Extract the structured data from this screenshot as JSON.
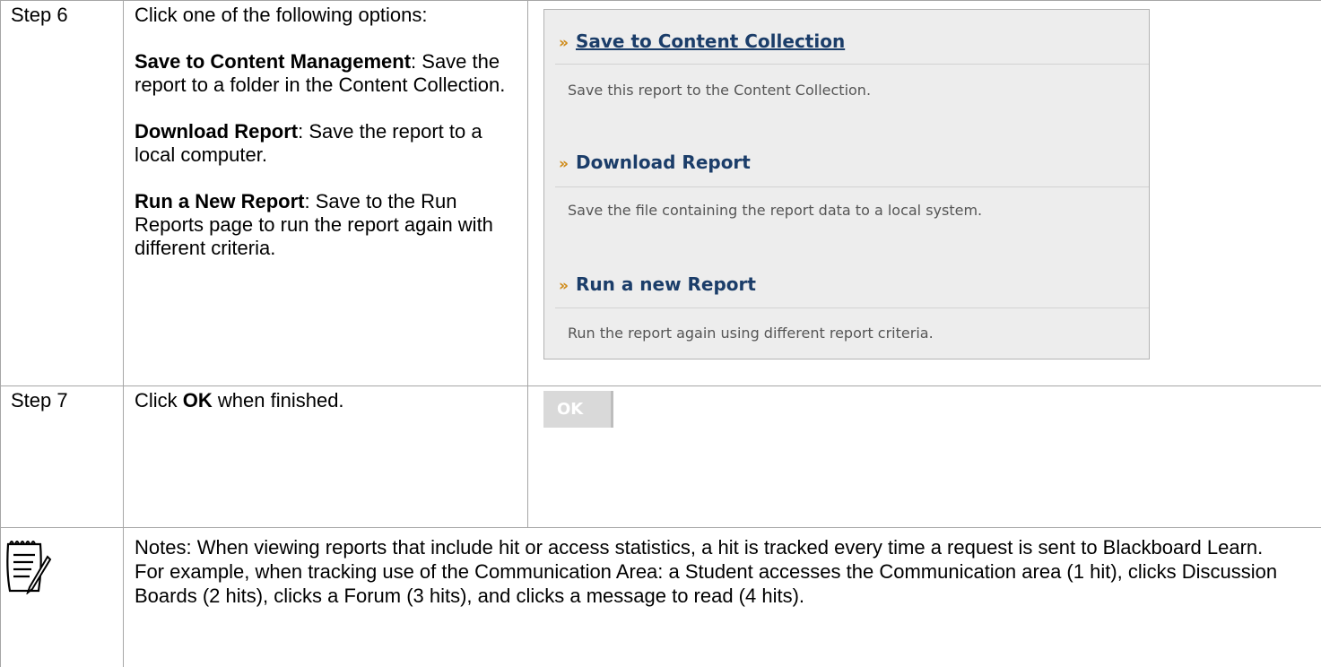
{
  "rows": [
    {
      "step": "Step 6",
      "intro": "Click one of the following options:",
      "options": [
        {
          "name": "Save to Content Management",
          "desc": ": Save the report to a folder in the Content Collection."
        },
        {
          "name": "Download Report",
          "desc": ": Save the report to a local computer."
        },
        {
          "name": "Run a New Report",
          "desc": ": Save to the Run Reports page to run the report again with different criteria."
        }
      ]
    },
    {
      "step": "Step 7",
      "pre": "Click ",
      "bold": "OK",
      "post": " when finished."
    }
  ],
  "panel": {
    "items": [
      {
        "title": "Save to Content Collection",
        "desc": "Save this report to the Content Collection.",
        "link": true
      },
      {
        "title": "Download Report",
        "desc": "Save the file containing the report data to a local system.",
        "link": false
      },
      {
        "title": "Run a new Report",
        "desc": "Run the report again using different report criteria.",
        "link": false
      }
    ],
    "chevron": "»"
  },
  "ok_button": {
    "label": "OK"
  },
  "notes": {
    "icon": "notepad-icon",
    "text": "Notes: When viewing reports that include hit or access statistics, a hit is tracked every time a request is sent to Blackboard Learn. For example, when tracking use of the Communication Area: a Student accesses the Communication area (1 hit), clicks Discussion Boards (2 hits), clicks a Forum (3 hits), and clicks a message to read (4 hits)."
  },
  "colors": {
    "panel_bg": "#ededed",
    "link_title": "#1b3d69",
    "chevron": "#cf8a17",
    "desc_text": "#555555",
    "border": "#a6a6a6"
  }
}
